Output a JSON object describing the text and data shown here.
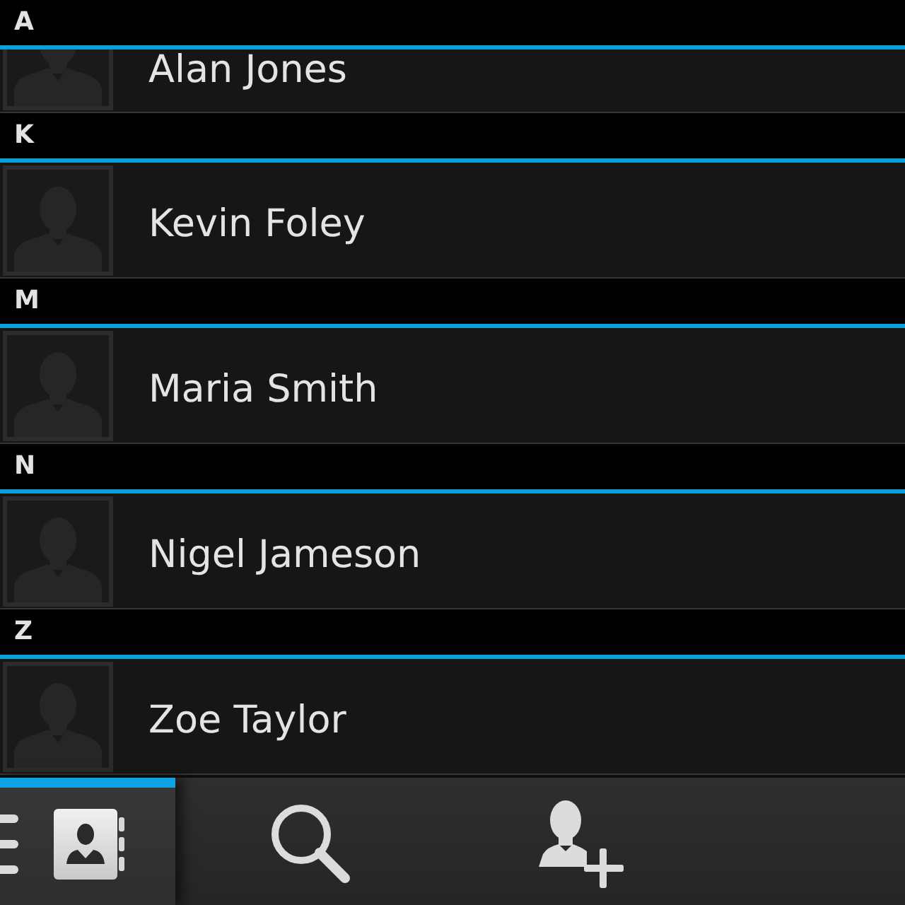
{
  "sections": [
    {
      "letter": "A",
      "contacts": [
        {
          "name": "Alan Jones"
        }
      ]
    },
    {
      "letter": "K",
      "contacts": [
        {
          "name": "Kevin Foley"
        }
      ]
    },
    {
      "letter": "M",
      "contacts": [
        {
          "name": "Maria Smith"
        }
      ]
    },
    {
      "letter": "N",
      "contacts": [
        {
          "name": "Nigel Jameson"
        }
      ]
    },
    {
      "letter": "Z",
      "contacts": [
        {
          "name": "Zoe Taylor"
        }
      ]
    }
  ],
  "action_bar": {
    "items": [
      {
        "kind": "tab_menu",
        "selected": true
      },
      {
        "kind": "search",
        "selected": false
      },
      {
        "kind": "add_contact",
        "selected": false
      }
    ]
  }
}
